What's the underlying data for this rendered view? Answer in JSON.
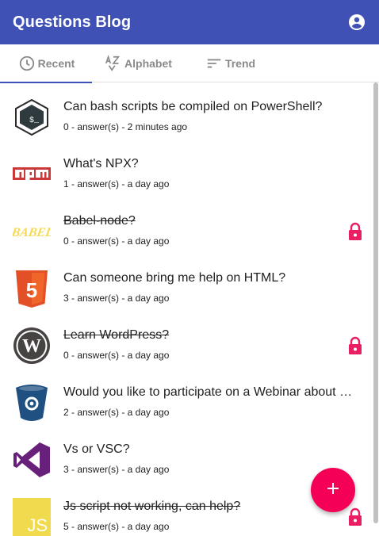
{
  "app": {
    "title": "Questions Blog"
  },
  "tabs": [
    {
      "label": "Recent",
      "icon": "clock-icon",
      "active": true
    },
    {
      "label": "Alphabet",
      "icon": "sort-alphabet-icon",
      "active": false
    },
    {
      "label": "Trend",
      "icon": "sort-trend-icon",
      "active": false
    }
  ],
  "questions": [
    {
      "title": "Can bash scripts be compiled on PowerShell?",
      "meta": "0 - answer(s) - 2 minutes ago",
      "icon": "bash-icon",
      "locked": false
    },
    {
      "title": "What's NPX?",
      "meta": "1 - answer(s) - a day ago",
      "icon": "npm-icon",
      "locked": false
    },
    {
      "title": "Babel-node?",
      "meta": "0 - answer(s) - a day ago",
      "icon": "babel-icon",
      "icon_text": "BABEL",
      "locked": true
    },
    {
      "title": "Can someone bring me help on HTML?",
      "meta": "3 - answer(s) - a day ago",
      "icon": "html5-icon",
      "icon_text": "5",
      "locked": false
    },
    {
      "title": "Learn WordPress?",
      "meta": "0 - answer(s) - a day ago",
      "icon": "wordpress-icon",
      "icon_text": "W",
      "locked": true
    },
    {
      "title": "Would you like to participate on a Webinar about Bitbucket?",
      "meta": "2 - answer(s) - a day ago",
      "icon": "bitbucket-icon",
      "locked": false
    },
    {
      "title": "Vs or VSC?",
      "meta": "3 - answer(s) - a day ago",
      "icon": "visual-studio-icon",
      "locked": false
    },
    {
      "title": "Js script not working, can help?",
      "meta": "5 - answer(s) - a day ago",
      "icon": "javascript-icon",
      "icon_text": "JS",
      "locked": true
    }
  ],
  "colors": {
    "appbar": "#3f51b5",
    "fab": "#f50057",
    "lock": "#e91e63",
    "tab_indicator": "#3f51b5"
  },
  "fab": {
    "icon": "plus-icon"
  }
}
